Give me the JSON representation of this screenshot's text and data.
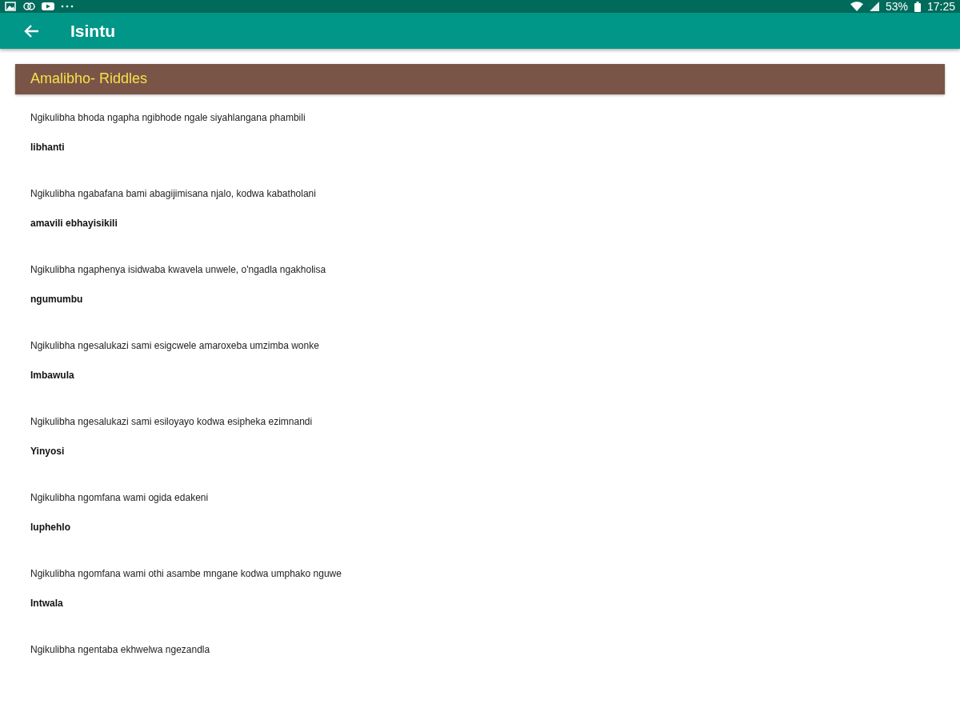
{
  "status_bar": {
    "battery": "53%",
    "time": "17:25"
  },
  "app_bar": {
    "title": "Isintu"
  },
  "section": {
    "title": "Amalibho- Riddles"
  },
  "riddles": [
    {
      "question": "Ngikulibha bhoda ngapha ngibhode ngale siyahlangana phambili",
      "answer": "libhanti"
    },
    {
      "question": "Ngikulibha ngabafana bami abagijimisana njalo, kodwa kabatholani",
      "answer": "amavili ebhayisikili"
    },
    {
      "question": "Ngikulibha ngaphenya isidwaba kwavela unwele, o'ngadla ngakholisa",
      "answer": "ngumumbu"
    },
    {
      "question": "Ngikulibha ngesalukazi sami esigcwele amaroxeba umzimba wonke",
      "answer": "Imbawula"
    },
    {
      "question": "Ngikulibha ngesalukazi sami esiloyayo kodwa esipheka ezimnandi",
      "answer": "Yinyosi"
    },
    {
      "question": "Ngikulibha ngomfana wami ogida edakeni",
      "answer": "luphehlo"
    },
    {
      "question": "Ngikulibha ngomfana wami othi asambe mngane kodwa umphako nguwe",
      "answer": "Intwala"
    },
    {
      "question": "Ngikulibha ngentaba ekhwelwa ngezandla"
    }
  ]
}
